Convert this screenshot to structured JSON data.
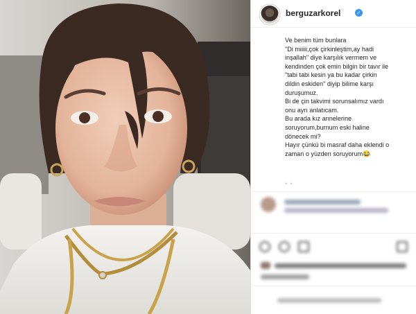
{
  "post": {
    "username": "berguzarkorel",
    "verified_glyph": "✓",
    "caption_lines": [
      "Ve benim tüm bunlara",
      "\"Di miiiii,çok çirkinleştim,ay hadi",
      "inşallah\" diye karşılık vermem ve",
      "kendinden çok emin bilgin bir tavır ile",
      "\"tabi tabi kesin ya bu kadar çirkin",
      "dildin eskiden\" diyip bilime karşı",
      "duruşumuz.",
      "Bi de çin takvimi sorunsalımız vardı",
      "onu ayrı anlatıcam.",
      "Bu arada kız annelerine",
      "soruyorum,burnum eski haline",
      "dönecek mi?",
      "Hayır çünkü bi masraf daha eklendi o",
      "zaman o yüzden soruyorum😂"
    ],
    "more_dots": "• •",
    "icons": {
      "avatar": "profile-avatar",
      "verified": "verified-badge-icon",
      "like": "heart-icon",
      "comment": "comment-icon",
      "share": "share-icon",
      "save": "bookmark-icon"
    },
    "colors": {
      "verified": "#3897f0",
      "text": "#262626",
      "border": "#dbdbdb"
    }
  }
}
